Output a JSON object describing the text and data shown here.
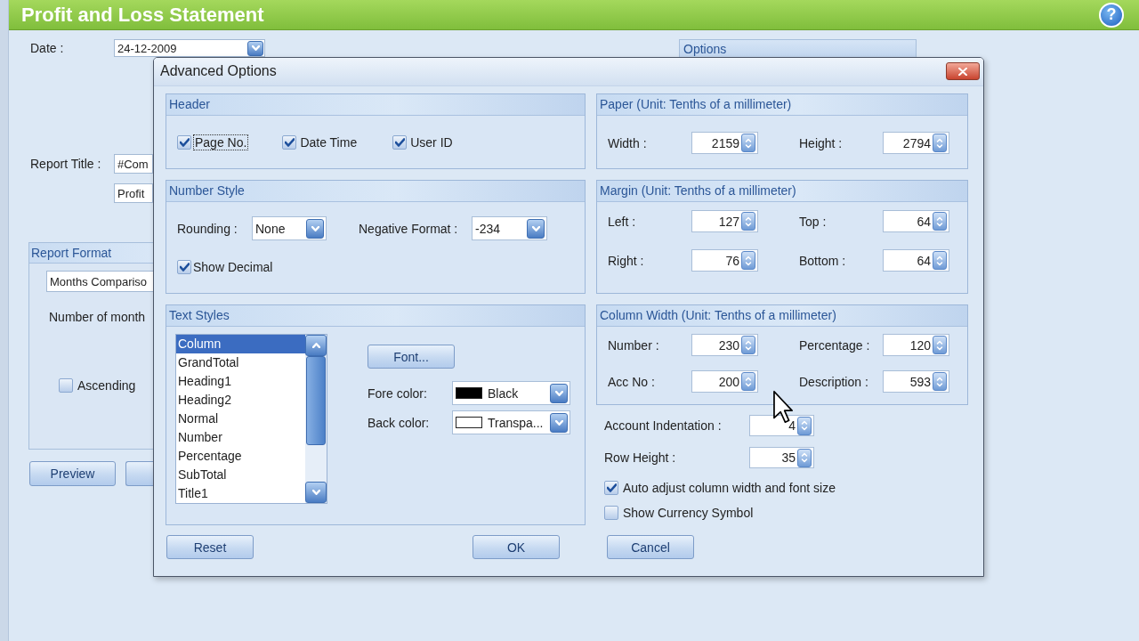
{
  "app": {
    "title": "Profit and Loss Statement",
    "help": "?"
  },
  "form": {
    "date": {
      "label": "Date :",
      "value": "24-12-2009"
    },
    "options_group": {
      "title": "Options"
    },
    "report_title": {
      "label": "Report Title :",
      "fields": [
        "#Com",
        "Profit"
      ]
    },
    "report_format": {
      "title": "Report Format",
      "format": "Months Compariso",
      "months_label": "Number of month",
      "ascending": {
        "label": "Ascending",
        "checked": false
      }
    },
    "buttons": [
      {
        "kind": "labeled",
        "label": "Preview"
      },
      {
        "kind": "covered"
      }
    ]
  },
  "dialog": {
    "title": "Advanced Options",
    "header": {
      "title": "Header",
      "checkboxes": [
        {
          "label": "Page No.",
          "checked": true,
          "focused": true
        },
        {
          "label": "Date Time",
          "checked": true,
          "focused": false
        },
        {
          "label": "User ID",
          "checked": true,
          "focused": false
        }
      ]
    },
    "number_style": {
      "title": "Number Style",
      "rounding": {
        "label": "Rounding :",
        "value": "None"
      },
      "negative_format": {
        "label": "Negative Format :",
        "value": "-234"
      },
      "show_decimal": {
        "label": "Show Decimal",
        "checked": true
      }
    },
    "text_styles": {
      "title": "Text Styles",
      "items": [
        {
          "label": "Column",
          "selected": true
        },
        {
          "label": "GrandTotal",
          "selected": false
        },
        {
          "label": "Heading1",
          "selected": false
        },
        {
          "label": "Heading2",
          "selected": false
        },
        {
          "label": "Normal",
          "selected": false
        },
        {
          "label": "Number",
          "selected": false
        },
        {
          "label": "Percentage",
          "selected": false
        },
        {
          "label": "SubTotal",
          "selected": false
        },
        {
          "label": "Title1",
          "selected": false
        }
      ],
      "font_button": "Font...",
      "color_pickers": [
        {
          "label": "Fore color:",
          "value": "Black",
          "color": "#000000"
        },
        {
          "label": "Back color:",
          "value": "Transpa...",
          "color": "#ffffff"
        }
      ]
    },
    "paper": {
      "title": "Paper (Unit: Tenths of a millimeter)",
      "fields": [
        {
          "label": "Width :",
          "value": "2159"
        },
        {
          "label": "Height :",
          "value": "2794"
        }
      ]
    },
    "margin": {
      "title": "Margin (Unit: Tenths of a millimeter)",
      "fields": [
        {
          "label": "Left :",
          "value": "127"
        },
        {
          "label": "Top :",
          "value": "64"
        },
        {
          "label": "Right :",
          "value": "76"
        },
        {
          "label": "Bottom :",
          "value": "64"
        }
      ]
    },
    "column_width": {
      "title": "Column Width (Unit: Tenths of a millimeter)",
      "fields": [
        {
          "label": "Number :",
          "value": "230"
        },
        {
          "label": "Percentage :",
          "value": "120"
        },
        {
          "label": "Acc No :",
          "value": "200"
        },
        {
          "label": "Description :",
          "value": "593"
        }
      ]
    },
    "extra_fields": [
      {
        "label": "Account Indentation :",
        "value": "4"
      },
      {
        "label": "Row Height :",
        "value": "35"
      }
    ],
    "options": [
      {
        "label": "Auto adjust column width and font size",
        "checked": true
      },
      {
        "label": "Show Currency Symbol",
        "checked": false
      }
    ],
    "buttons": {
      "reset": "Reset",
      "ok": "OK",
      "cancel": "Cancel"
    }
  }
}
